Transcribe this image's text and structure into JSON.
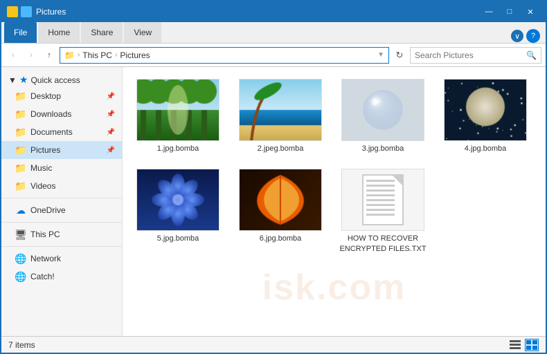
{
  "window": {
    "title": "Pictures",
    "titlebar_icons": [
      "yellow-icon",
      "blue-icon"
    ],
    "controls": {
      "minimize": "—",
      "maximize": "□",
      "close": "✕"
    }
  },
  "ribbon": {
    "tabs": [
      {
        "label": "File",
        "active": true
      },
      {
        "label": "Home",
        "active": false
      },
      {
        "label": "Share",
        "active": false
      },
      {
        "label": "View",
        "active": false
      }
    ],
    "help_btn": "?"
  },
  "addressbar": {
    "back_btn": "‹",
    "forward_btn": "›",
    "up_btn": "↑",
    "path_parts": [
      "This PC",
      "Pictures"
    ],
    "path_icon": "📁",
    "refresh_btn": "↻",
    "search_placeholder": "Search Pictures"
  },
  "sidebar": {
    "quick_access_label": "Quick access",
    "items": [
      {
        "id": "desktop",
        "label": "Desktop",
        "icon": "📁",
        "pinned": true
      },
      {
        "id": "downloads",
        "label": "Downloads",
        "icon": "📁",
        "pinned": true
      },
      {
        "id": "documents",
        "label": "Documents",
        "icon": "📁",
        "pinned": true
      },
      {
        "id": "pictures",
        "label": "Pictures",
        "icon": "📁",
        "pinned": true,
        "active": true
      },
      {
        "id": "music",
        "label": "Music",
        "icon": "📁",
        "pinned": false
      },
      {
        "id": "videos",
        "label": "Videos",
        "icon": "📁",
        "pinned": false
      }
    ],
    "onedrive_label": "OneDrive",
    "thispc_label": "This PC",
    "network_label": "Network",
    "catch_label": "Catch!"
  },
  "files": [
    {
      "name": "1.jpg.bomba",
      "type": "image",
      "color1": "#2d6a1f",
      "color2": "#87c55a",
      "color3": "#1a8c3e"
    },
    {
      "name": "2.jpeg.bomba",
      "type": "image",
      "color1": "#38a0c0",
      "color2": "#7dd6f0",
      "color3": "#1e7a9e"
    },
    {
      "name": "3.jpg.bomba",
      "type": "image",
      "color1": "#c5c5c5",
      "color2": "#e8e8e8",
      "color3": "#888"
    },
    {
      "name": "4.jpg.bomba",
      "type": "image",
      "color1": "#1a3a5c",
      "color2": "#3a6fa0",
      "color3": "#6aabdc"
    },
    {
      "name": "5.jpg.bomba",
      "type": "image",
      "color1": "#1a3a8c",
      "color2": "#2a5ad0",
      "color3": "#3a7aff"
    },
    {
      "name": "6.jpg.bomba",
      "type": "image",
      "color1": "#c85a10",
      "color2": "#f0a030",
      "color3": "#8a3a05"
    },
    {
      "name": "HOW TO RECOVER ENCRYPTED FILES.TXT",
      "type": "txt"
    }
  ],
  "statusbar": {
    "count": "7 items"
  },
  "watermark": "isk.com"
}
